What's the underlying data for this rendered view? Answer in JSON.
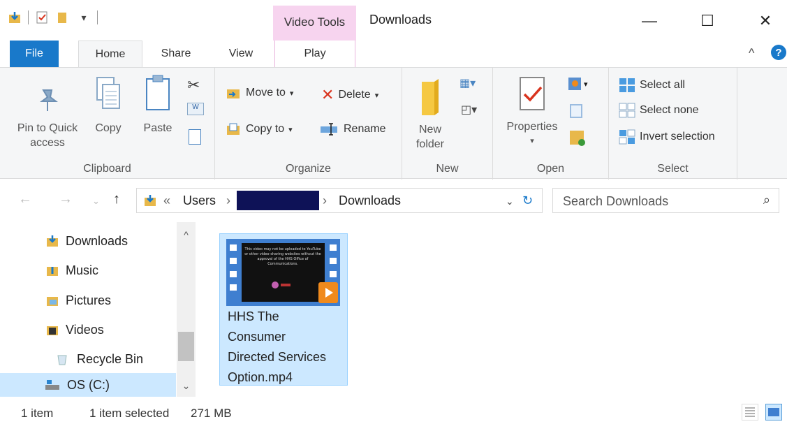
{
  "title_bar": {
    "context_tab": "Video Tools",
    "window_title": "Downloads",
    "minimize": "—",
    "maximize": "☐",
    "close": "✕"
  },
  "tabs": [
    "File",
    "Home",
    "Share",
    "View",
    "Play"
  ],
  "ribbon": {
    "clipboard": {
      "label": "Clipboard",
      "pin_line1": "Pin to Quick",
      "pin_line2": "access",
      "copy": "Copy",
      "paste": "Paste"
    },
    "organize": {
      "label": "Organize",
      "move_to": "Move to",
      "copy_to": "Copy to",
      "delete": "Delete",
      "rename": "Rename"
    },
    "new": {
      "label": "New",
      "new_folder_line1": "New",
      "new_folder_line2": "folder"
    },
    "open": {
      "label": "Open",
      "properties": "Properties"
    },
    "select": {
      "label": "Select",
      "select_all": "Select all",
      "select_none": "Select none",
      "invert": "Invert selection"
    }
  },
  "address": {
    "prefix": "«",
    "segment1": "Users",
    "segment2": "Downloads",
    "search_placeholder": "Search Downloads"
  },
  "nav_pane": [
    {
      "label": "Downloads",
      "icon": "downloads-icon"
    },
    {
      "label": "Music",
      "icon": "music-icon"
    },
    {
      "label": "Pictures",
      "icon": "pictures-icon"
    },
    {
      "label": "Videos",
      "icon": "videos-icon"
    },
    {
      "label": "Recycle Bin",
      "icon": "recycle-bin-icon"
    },
    {
      "label": "OS (C:)",
      "icon": "drive-icon"
    }
  ],
  "file": {
    "name_line1": "HHS The",
    "name_line2": "Consumer",
    "name_line3": "Directed Services",
    "name_line4": "Option.mp4",
    "thumb_text": "This video may not be uploaded to YouTube or other video-sharing websites without the approval of the HHS Office of Communications."
  },
  "status": {
    "count": "1 item",
    "selected": "1 item selected",
    "size": "271 MB"
  },
  "colors": {
    "accent": "#1979ca",
    "selection": "#cce8ff",
    "context_tab": "#f7d4ef",
    "redaction": "#0e1257"
  }
}
